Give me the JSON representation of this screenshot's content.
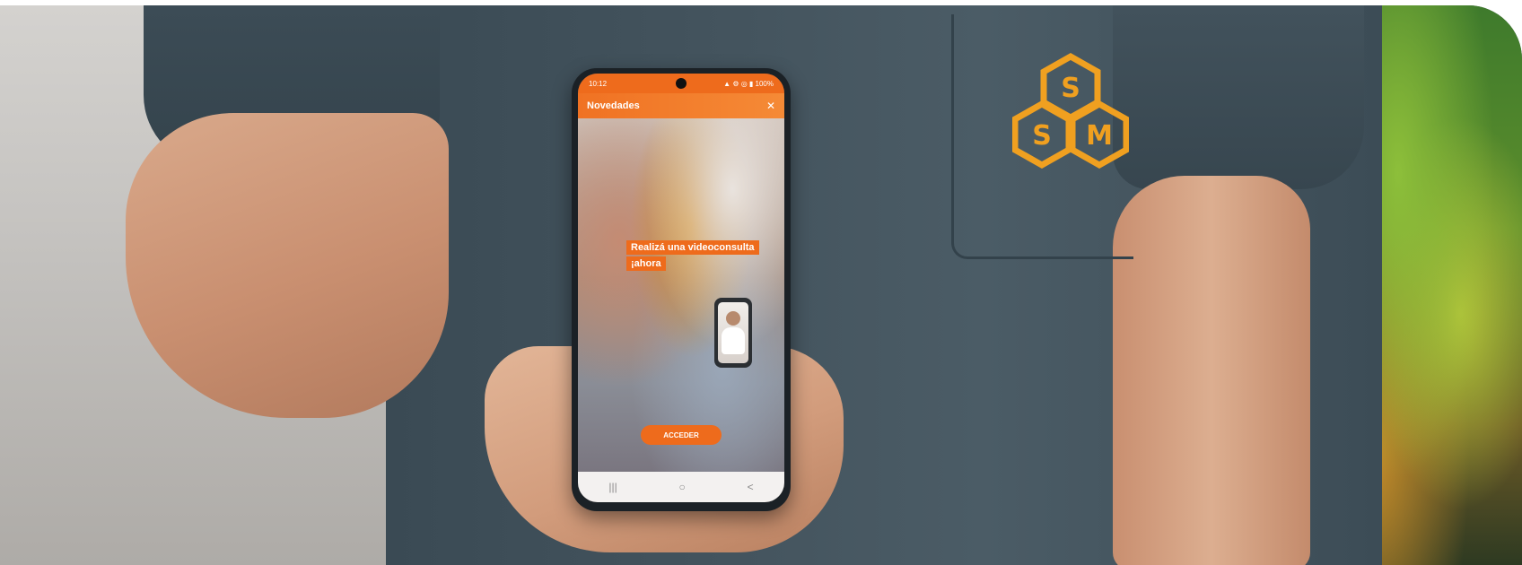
{
  "phone": {
    "status_time": "10:12",
    "status_icons": "▲ ⚙ ◎ ▮ 100%",
    "app_bar_title": "Novedades",
    "close_label": "✕",
    "promo_headline_line1": "Realizá una videoconsulta",
    "promo_headline_line2": "¡ahora",
    "cta_label": "ACCEDER",
    "nav_buttons": [
      "|||",
      "○",
      "<"
    ]
  },
  "logo": {
    "letters": [
      "S",
      "S",
      "M"
    ],
    "color": "#f0a020"
  },
  "colors": {
    "accent": "#ee6b1c",
    "scrubs": "#44545e"
  }
}
